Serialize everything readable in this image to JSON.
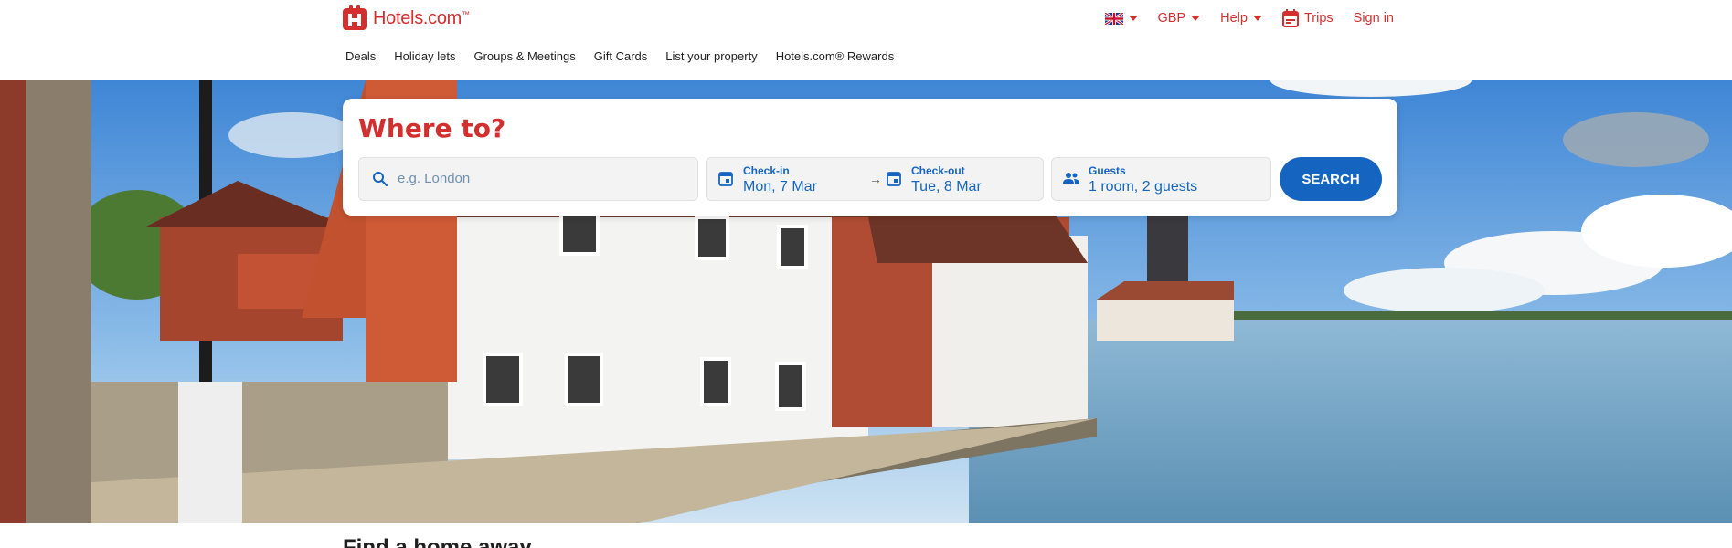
{
  "brand": {
    "name": "Hotels.com",
    "tm": "™",
    "color": "#d32f2f"
  },
  "topbar": {
    "language_icon": "uk-flag-icon",
    "currency": "GBP",
    "help": "Help",
    "trips": "Trips",
    "sign_in": "Sign in"
  },
  "nav": {
    "items": [
      "Deals",
      "Holiday lets",
      "Groups & Meetings",
      "Gift Cards",
      "List your property",
      "Hotels.com® Rewards"
    ]
  },
  "search": {
    "title": "Where to?",
    "destination_placeholder": "e.g. London",
    "checkin_label": "Check-in",
    "checkin_value": "Mon, 7 Mar",
    "checkout_label": "Check-out",
    "checkout_value": "Tue, 8 Mar",
    "guests_label": "Guests",
    "guests_value": "1 room, 2 guests",
    "button": "SEARCH",
    "accent": "#1565c0"
  },
  "section": {
    "heading": "Find a home away"
  },
  "colors": {
    "brand_red": "#d32f2f",
    "accent_blue": "#1565c0"
  }
}
